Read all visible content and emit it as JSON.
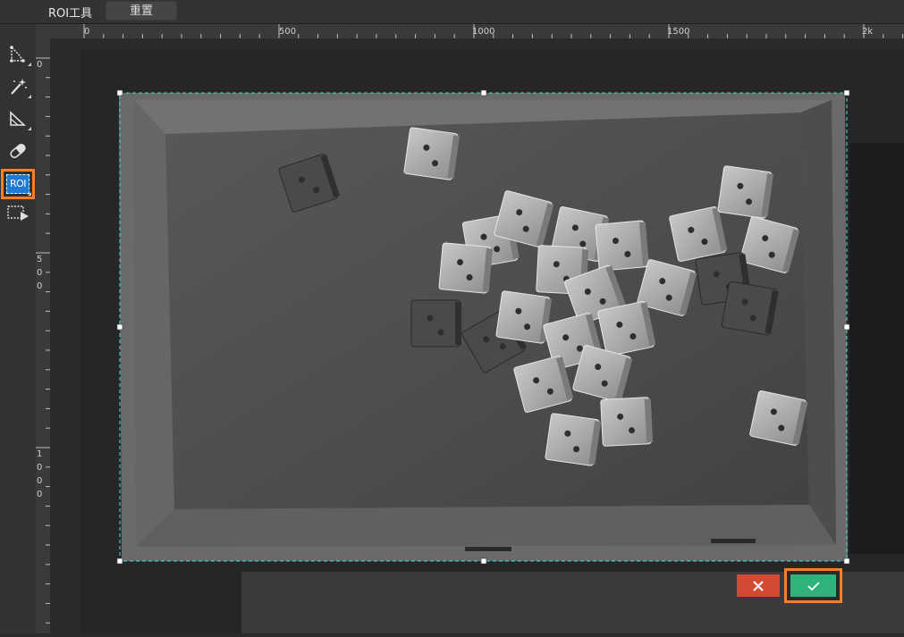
{
  "window": {
    "title": "ROI工具",
    "reset_label": "重置"
  },
  "toolbar": {
    "tools": [
      {
        "name": "polygon-select-tool",
        "icon": "polygon-select-icon"
      },
      {
        "name": "magic-wand-tool",
        "icon": "magic-wand-icon"
      },
      {
        "name": "corner-shape-tool",
        "icon": "corner-shape-icon"
      },
      {
        "name": "eraser-tool",
        "icon": "eraser-icon"
      },
      {
        "name": "roi-tool",
        "icon": "roi-icon",
        "label": "ROI",
        "active": true
      },
      {
        "name": "roi-play-tool",
        "icon": "roi-play-icon"
      }
    ]
  },
  "rulers": {
    "horizontal_labels": [
      "0",
      "500",
      "1000",
      "1500",
      "2k"
    ],
    "vertical_labels": [
      "0",
      "500",
      "1000"
    ]
  },
  "actions": {
    "cancel_icon": "close-icon",
    "confirm_icon": "check-icon"
  },
  "colors": {
    "active_highlight": "#ff7f27",
    "roi_tool_blue": "#1f7ad3",
    "roi_dashed_line": "#3fe0d0",
    "cancel_red": "#d24a32",
    "confirm_green": "#2fb37a"
  }
}
